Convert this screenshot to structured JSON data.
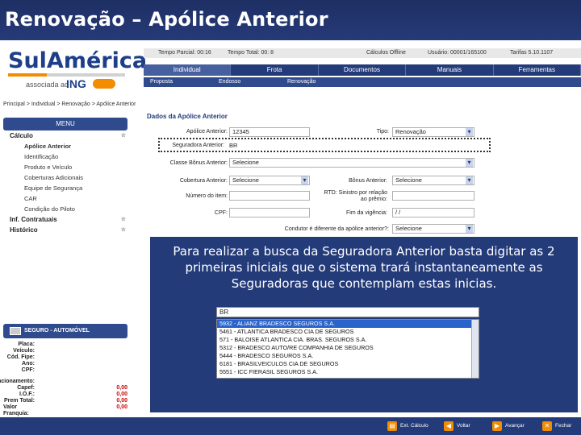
{
  "slide_title": "Renovação – Apólice Anterior",
  "brand": {
    "name": "SulAmérica",
    "sub": "associada ao",
    "partner": "ING"
  },
  "status_bar": {
    "tempo_parcial": "Tempo Parcial: 00:16",
    "tempo_total": "Tempo Total: 00: 8",
    "calculos": "Cálculos Offline",
    "usuario": "Usuário: 00001/165100",
    "tarifas": "Tarifas 5.10.1107"
  },
  "tabs": [
    "Individual",
    "Frota",
    "Documentos",
    "Manuais",
    "Ferramentas"
  ],
  "subtabs": [
    "Proposta",
    "Endosso",
    "Renovação"
  ],
  "breadcrumb": "Principal > Individual > Renovação > Apólice Anterior",
  "menu": {
    "header": "MENU",
    "items": [
      {
        "label": "Cálculo",
        "bold": true,
        "star": "☆"
      },
      {
        "label": "Apólice Anterior",
        "sub": true,
        "active": true
      },
      {
        "label": "Identificação",
        "sub": true
      },
      {
        "label": "Produto e Veículo",
        "sub": true
      },
      {
        "label": "Coberturas Adicionais",
        "sub": true
      },
      {
        "label": "Equipe de Segurança",
        "sub": true
      },
      {
        "label": "CAR",
        "sub": true
      },
      {
        "label": "Condição do Piloto",
        "sub": true
      },
      {
        "label": "Inf. Contratuais",
        "bold": true,
        "star": "☆"
      },
      {
        "label": "Histórico",
        "bold": true,
        "star": "☆"
      }
    ]
  },
  "seguro": {
    "header": "SEGURO - AUTOMÓVEL",
    "rows": [
      {
        "label": "Placa:",
        "value": ""
      },
      {
        "label": "Veículo:",
        "value": ""
      },
      {
        "label": "Cód. Fipe:",
        "value": ""
      },
      {
        "label": "Ano:",
        "value": ""
      },
      {
        "label": "CPF:",
        "value": ""
      },
      {
        "label": "Fracionamento:",
        "value": ""
      },
      {
        "label": "Capef:",
        "value": "0,00"
      },
      {
        "label": "I.O.F.:",
        "value": "0,00"
      },
      {
        "label": "Prem Total:",
        "value": "0,00"
      },
      {
        "label": "Valor Franquia:",
        "value": "0,00"
      }
    ]
  },
  "form": {
    "section_title": "Dados da Apólice Anterior",
    "apolice_label": "Apólice Anterior:",
    "apolice_value": "12345",
    "tipo_label": "Tipo:",
    "tipo_value": "Renovação",
    "seguradora_label": "Seguradora Anterior:",
    "seguradora_value": "BR",
    "classe_label": "Classe Bônus Anterior:",
    "classe_value": "Selecione",
    "cobertura_label": "Cobertura Anterior:",
    "cobertura_value": "Selecione",
    "bonus_label": "Bônus Anterior:",
    "bonus_value": "Selecione",
    "item_label": "Número do item:",
    "item_value": "",
    "rtd_label": "RTD: Sinistro por relação ao prêmio:",
    "rtd_value": "",
    "cpf_label": "CPF:",
    "cpf_value": "",
    "fim_label": "Fim da vigência:",
    "fim_value": "/ /",
    "condutor_label": "Condutor é diferente da apólice anterior?:",
    "condutor_value": "Selecione"
  },
  "overlay": {
    "text": "Para realizar a busca da Seguradora Anterior basta digitar as 2 primeiras iniciais que o sistema trará instantaneamente as Seguradoras  que contemplam estas inicias."
  },
  "dropdown": {
    "input_value": "BR",
    "items": [
      "5932 - ALIANZ BRADESCO SEGUROS S.A.",
      "5461 - ATLANTICA BRADESCO CIA DE SEGUROS",
      "571 - BALOISE ATLANTICA CIA. BRAS. SEGUROS S.A.",
      "5312 - BRADESCO AUTO/RE COMPANHIA DE SEGUROS",
      "5444 - BRADESCO SEGUROS S.A.",
      "6181 - BRASILVEICULOS CIA DE SEGUROS",
      "5551 - ICC FIERASIL SEGUROS S.A."
    ],
    "selected_index": 0
  },
  "bottom_buttons": [
    "Ext. Cálculo",
    "Voltar",
    "Avançar",
    "Fechar"
  ],
  "colors": {
    "primary": "#243b7a",
    "accent": "#f28c00",
    "selected": "#2a63c9"
  }
}
